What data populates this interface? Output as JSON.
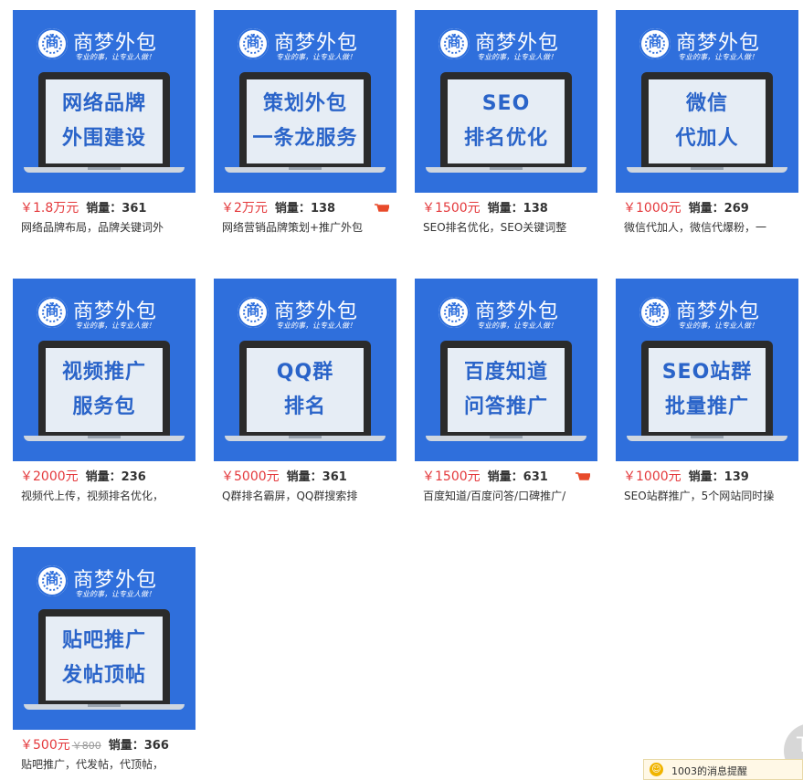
{
  "brand": {
    "seal_char": "商",
    "name": "商梦外包",
    "slogan": "专业的事，让专业人做！"
  },
  "currency": "￥",
  "sales_label": "销量：",
  "products": [
    {
      "line1": "网络品牌",
      "line2": "外围建设",
      "price": "1.8万元",
      "old_price": "",
      "sales": "361",
      "desc": "网络品牌布局，品牌关键词外",
      "cart": false
    },
    {
      "line1": "策划外包",
      "line2": "一条龙服务",
      "price": "2万元",
      "old_price": "",
      "sales": "138",
      "desc": "网络营销品牌策划+推广外包",
      "cart": true
    },
    {
      "line1": "SEO",
      "line2": "排名优化",
      "price": "1500元",
      "old_price": "",
      "sales": "138",
      "desc": "SEO排名优化，SEO关键词整",
      "cart": false
    },
    {
      "line1": "微信",
      "line2": "代加人",
      "price": "1000元",
      "old_price": "",
      "sales": "269",
      "desc": "微信代加人，微信代爆粉，一",
      "cart": false
    },
    {
      "line1": "视频推广",
      "line2": "服务包",
      "price": "2000元",
      "old_price": "",
      "sales": "236",
      "desc": "视频代上传，视频排名优化，",
      "cart": false
    },
    {
      "line1": "QQ群",
      "line2": "排名",
      "price": "5000元",
      "old_price": "",
      "sales": "361",
      "desc": "Q群排名霸屏，QQ群搜索排",
      "cart": false
    },
    {
      "line1": "百度知道",
      "line2": "问答推广",
      "price": "1500元",
      "old_price": "",
      "sales": "631",
      "desc": "百度知道/百度问答/口碑推广/",
      "cart": true
    },
    {
      "line1": "SEO站群",
      "line2": "批量推广",
      "price": "1000元",
      "old_price": "",
      "sales": "139",
      "desc": "SEO站群推广，5个网站同时操",
      "cart": false
    },
    {
      "line1": "贴吧推广",
      "line2": "发帖顶帖",
      "price": "500元",
      "old_price": "￥800",
      "sales": "366",
      "desc": "贴吧推广，代发帖，代顶帖，",
      "cart": false
    }
  ],
  "float_button": {
    "label": "T"
  },
  "notification": {
    "text": "1003的消息提醒"
  },
  "colors": {
    "tile_blue": "#2f6fdc",
    "price_red": "#e4393c",
    "cart_red": "#e84a2a"
  }
}
